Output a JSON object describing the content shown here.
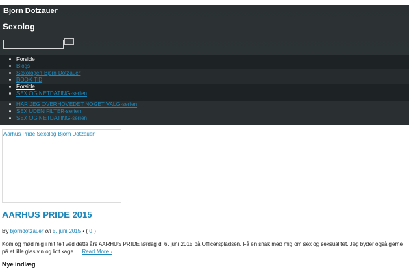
{
  "site": {
    "title": "Bjorn Dotzauer",
    "tagline": "Sexolog"
  },
  "search": {
    "placeholder": ""
  },
  "nav": {
    "items": [
      {
        "label": "Forside"
      },
      {
        "label": "Blogs"
      },
      {
        "label": "Sexologen Bjorn Dotzauer"
      },
      {
        "label": "BOOK TID"
      },
      {
        "label": "Forside",
        "children": [
          {
            "label": "SEX OG NETDATING-serien"
          }
        ]
      }
    ],
    "extra": [
      {
        "label": "HAR JEG OVERHOVEDET NOGET VALG-serien"
      },
      {
        "label": "SEX UDEN FILTER-serien"
      },
      {
        "label": "SEX OG NETDATING-serien"
      }
    ]
  },
  "post": {
    "thumb_alt": "Aarhus Pride Sexolog Bjorn Dotzauer",
    "title": "AARHUS PRIDE 2015",
    "meta": {
      "by": "By",
      "author": "bjorndotzauer",
      "on": "on",
      "date": "5. juni 2015",
      "sep": "• (",
      "comments": "0",
      "close": ")"
    },
    "excerpt": "Kom og mød mig i mit telt ved dette års AARHUS PRIDE lørdag d. 6. juni 2015 på Officerspladsen. Få en snak med mig om sex og seksualitet. Jeg byder også gerne på et lille glas vin og lidt kage.… ",
    "read_more": "Read More ›"
  },
  "sidebar": {
    "recent_title": "Nye indlæg"
  },
  "colors": {
    "header": "#2b3133",
    "link": "#1e86b8"
  }
}
